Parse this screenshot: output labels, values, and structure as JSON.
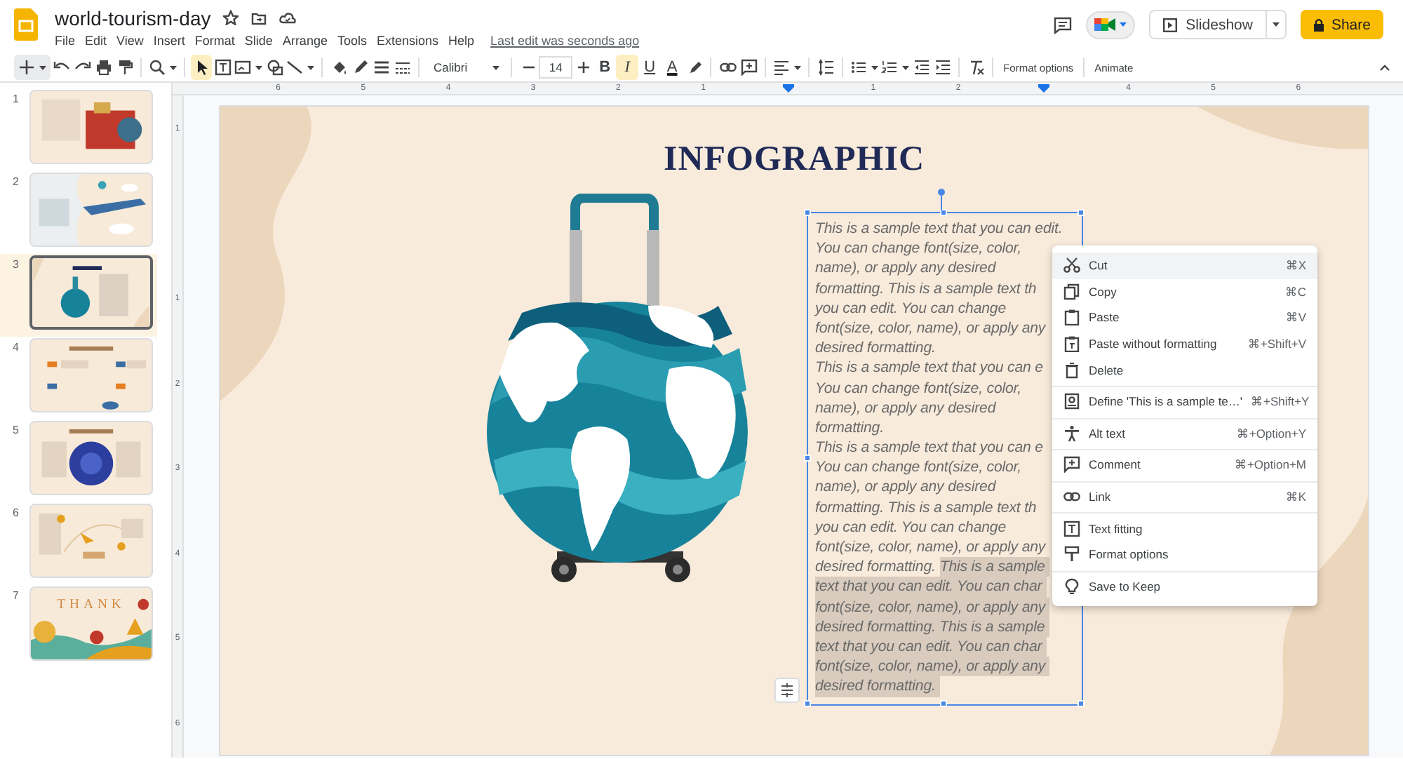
{
  "document": {
    "title": "world-tourism-day",
    "last_edit": "Last edit was seconds ago"
  },
  "menu_bar": [
    "File",
    "Edit",
    "View",
    "Insert",
    "Format",
    "Slide",
    "Arrange",
    "Tools",
    "Extensions",
    "Help"
  ],
  "header_buttons": {
    "slideshow": "Slideshow",
    "share": "Share"
  },
  "toolbar": {
    "select_tool_selected": true,
    "font": "Calibri",
    "font_size": "14",
    "text_styles": [
      {
        "label": "B",
        "selected": false
      },
      {
        "label": "I",
        "selected": true
      },
      {
        "label": "U",
        "selected": false
      },
      {
        "label": "A",
        "selected": false
      }
    ],
    "buttons": [
      "Format options",
      "Animate"
    ]
  },
  "ruler": {
    "horizontal": [
      "6",
      "5",
      "4",
      "3",
      "2",
      "1",
      "1",
      "2",
      "4",
      "5",
      "6"
    ],
    "vertical": [
      "1",
      "1",
      "2",
      "3",
      "4",
      "5",
      "6"
    ]
  },
  "filmstrip": [
    {
      "number": "1",
      "selected": false
    },
    {
      "number": "2",
      "selected": false
    },
    {
      "number": "3",
      "selected": true
    },
    {
      "number": "4",
      "selected": false
    },
    {
      "number": "5",
      "selected": false
    },
    {
      "number": "6",
      "selected": false
    },
    {
      "number": "7",
      "selected": false,
      "caption": "THANK"
    }
  ],
  "slide": {
    "title": "INFOGRAPHIC",
    "text_box": {
      "lines": [
        {
          "parts": [
            {
              "text": "This is a sample text that you can edit.",
              "selected": false
            }
          ]
        },
        {
          "parts": [
            {
              "text": "You can change font(size, color,",
              "selected": false
            }
          ]
        },
        {
          "parts": [
            {
              "text": "name), or apply any desired",
              "selected": false
            }
          ]
        },
        {
          "parts": [
            {
              "text": "formatting. This is a sample text th",
              "selected": false
            }
          ]
        },
        {
          "parts": [
            {
              "text": "you can edit. You can change",
              "selected": false
            }
          ]
        },
        {
          "parts": [
            {
              "text": "font(size, color, name), or apply any",
              "selected": false
            }
          ]
        },
        {
          "parts": [
            {
              "text": "desired formatting.",
              "selected": false
            }
          ]
        },
        {
          "parts": [
            {
              "text": "This is a sample text that you can e",
              "selected": false
            }
          ]
        },
        {
          "parts": [
            {
              "text": "You can change font(size, color,",
              "selected": false
            }
          ]
        },
        {
          "parts": [
            {
              "text": "name), or apply any desired",
              "selected": false
            }
          ]
        },
        {
          "parts": [
            {
              "text": "formatting.",
              "selected": false
            }
          ]
        },
        {
          "parts": [
            {
              "text": "This is a sample text that you can e",
              "selected": false
            }
          ]
        },
        {
          "parts": [
            {
              "text": "You can change font(size, color,",
              "selected": false
            }
          ]
        },
        {
          "parts": [
            {
              "text": "name), or apply any desired",
              "selected": false
            }
          ]
        },
        {
          "parts": [
            {
              "text": "formatting. This is a sample text th",
              "selected": false
            }
          ]
        },
        {
          "parts": [
            {
              "text": "you can edit. You can change",
              "selected": false
            }
          ]
        },
        {
          "parts": [
            {
              "text": "font(size, color, name), or apply any",
              "selected": false
            }
          ]
        },
        {
          "parts": [
            {
              "text": "desired formatting.",
              "selected": false
            },
            {
              "text": "This is a sample",
              "selected": true
            }
          ]
        },
        {
          "parts": [
            {
              "text": "text that you can edit. You can char",
              "selected": true
            }
          ]
        },
        {
          "parts": [
            {
              "text": "font(size, color, name), or apply any",
              "selected": true
            }
          ]
        },
        {
          "parts": [
            {
              "text": "desired formatting. This is a sample",
              "selected": true
            }
          ]
        },
        {
          "parts": [
            {
              "text": "text that you can edit. You can char",
              "selected": true
            }
          ]
        },
        {
          "parts": [
            {
              "text": "font(size, color, name), or apply any",
              "selected": true
            }
          ]
        },
        {
          "parts": [
            {
              "text": "desired formatting.",
              "selected": true
            }
          ]
        }
      ]
    }
  },
  "context_menu": {
    "groups": [
      {
        "items": [
          {
            "label": "Cut",
            "shortcut": "⌘X",
            "selected": true
          },
          {
            "label": "Copy",
            "shortcut": "⌘C",
            "selected": false
          },
          {
            "label": "Paste",
            "shortcut": "⌘V",
            "selected": false
          },
          {
            "label": "Paste without formatting",
            "shortcut": "⌘+Shift+V",
            "selected": false
          },
          {
            "label": "Delete",
            "selected": false
          }
        ]
      },
      {
        "items": [
          {
            "label": "Define 'This is a sample te…'",
            "shortcut": "⌘+Shift+Y",
            "selected": false
          }
        ]
      },
      {
        "items": [
          {
            "label": "Alt text",
            "shortcut": "⌘+Option+Y",
            "selected": false
          }
        ]
      },
      {
        "items": [
          {
            "label": "Comment",
            "shortcut": "⌘+Option+M",
            "selected": false
          }
        ]
      },
      {
        "items": [
          {
            "label": "Link",
            "shortcut": "⌘K",
            "selected": false
          }
        ]
      },
      {
        "items": [
          {
            "label": "Text fitting",
            "selected": false
          },
          {
            "label": "Format options",
            "selected": false
          }
        ]
      },
      {
        "items": [
          {
            "label": "Save to Keep",
            "selected": false
          }
        ]
      }
    ]
  }
}
